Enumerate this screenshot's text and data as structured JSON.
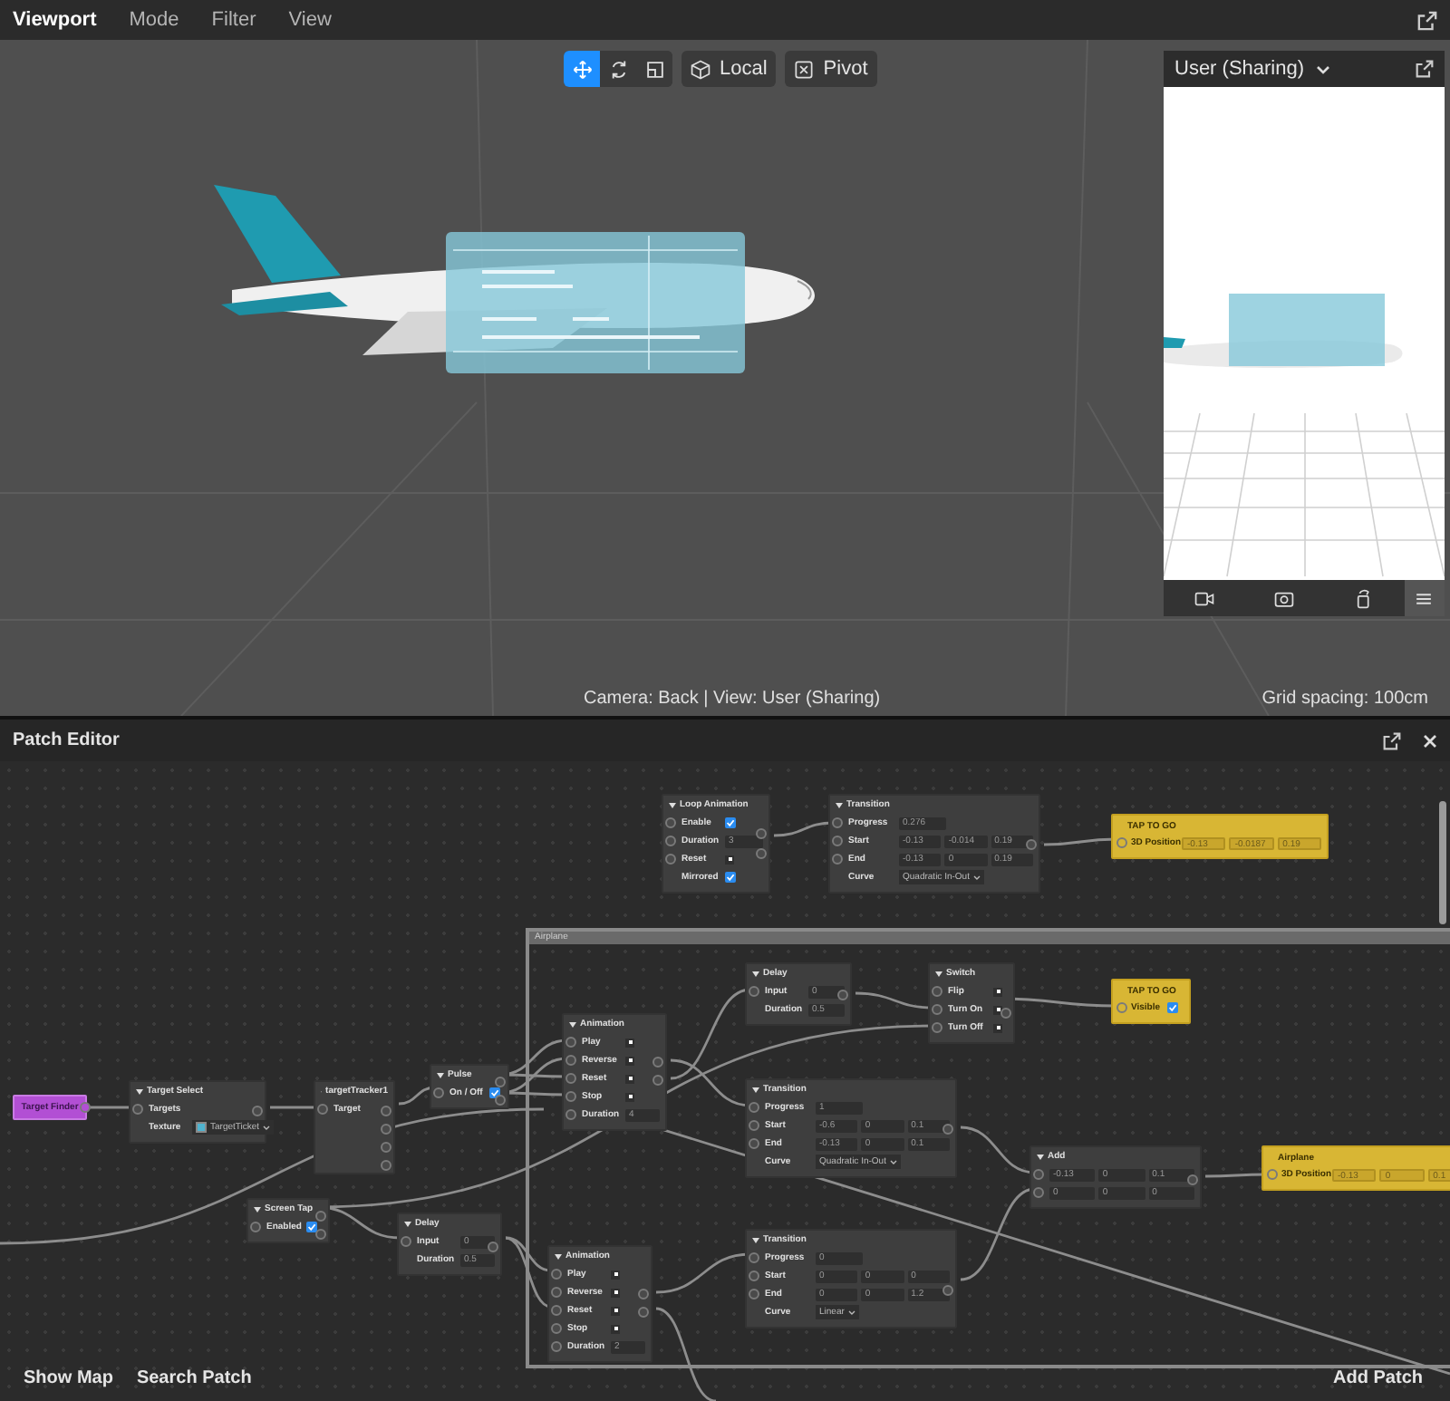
{
  "menu": [
    {
      "label": "Viewport",
      "selected": true
    },
    {
      "label": "Mode",
      "selected": false
    },
    {
      "label": "Filter",
      "selected": false
    },
    {
      "label": "View",
      "selected": false
    }
  ],
  "toolbar": {
    "tools": [
      {
        "kind": "move",
        "selected": true
      },
      {
        "kind": "rotate",
        "selected": false
      },
      {
        "kind": "scale",
        "selected": false
      }
    ],
    "buttons": [
      {
        "kind": "cube",
        "label": "Local"
      },
      {
        "kind": "pivot",
        "label": "Pivot"
      }
    ]
  },
  "preview": {
    "title": "User (Sharing)",
    "tools": [
      {
        "kind": "video",
        "selected": false
      },
      {
        "kind": "camera",
        "selected": false
      },
      {
        "kind": "rotate",
        "selected": false
      },
      {
        "kind": "menu",
        "selected": true
      }
    ]
  },
  "status": {
    "view": "Camera: Back | View: User (Sharing)",
    "grid": "Grid spacing: 100cm"
  },
  "patch_editor": {
    "title": "Patch Editor",
    "groups": [
      {
        "title": "Airplane"
      }
    ],
    "nodes": [
      {
        "kind": "patch",
        "title": "Loop Animation",
        "rows": [
          {
            "kind": "checkbox",
            "label": "Enable",
            "port": true,
            "checked": true
          },
          {
            "kind": "value",
            "label": "Duration",
            "port": true,
            "value": "3"
          },
          {
            "kind": "pulse",
            "label": "Reset",
            "port": true
          },
          {
            "kind": "checkbox",
            "label": "Mirrored",
            "port": false,
            "checked": true
          }
        ]
      },
      {
        "kind": "patch",
        "title": "Transition",
        "rows": [
          {
            "kind": "value",
            "label": "Progress",
            "port": true,
            "value": "0.276"
          },
          {
            "kind": "vector",
            "label": "Start",
            "port": true,
            "values": [
              "-0.13",
              "-0.014",
              "0.19"
            ]
          },
          {
            "kind": "vector",
            "label": "End",
            "port": true,
            "values": [
              "-0.13",
              "0",
              "0.19"
            ]
          },
          {
            "kind": "dropdown",
            "label": "Curve",
            "port": false,
            "value": "Quadratic In-Out"
          }
        ]
      },
      {
        "kind": "object",
        "title": "TAP TO GO",
        "rows": [
          {
            "kind": "vector",
            "label": "3D Position",
            "port": true,
            "values": [
              "-0.13",
              "-0.0187",
              "0.19"
            ]
          }
        ]
      },
      {
        "kind": "patch",
        "title": "Delay",
        "rows": [
          {
            "kind": "value",
            "label": "Input",
            "port": true,
            "value": "0"
          },
          {
            "kind": "value",
            "label": "Duration",
            "port": false,
            "value": "0.5"
          }
        ]
      },
      {
        "kind": "patch",
        "title": "Switch",
        "rows": [
          {
            "kind": "pulse",
            "label": "Flip",
            "port": true
          },
          {
            "kind": "pulse",
            "label": "Turn On",
            "port": true
          },
          {
            "kind": "pulse",
            "label": "Turn Off",
            "port": true
          }
        ]
      },
      {
        "kind": "object",
        "title": "TAP TO GO",
        "rows": [
          {
            "kind": "checkbox",
            "label": "Visible",
            "port": true,
            "checked": true
          }
        ]
      },
      {
        "kind": "patch",
        "title": "Animation",
        "rows": [
          {
            "kind": "pulse",
            "label": "Play",
            "port": true
          },
          {
            "kind": "pulse",
            "label": "Reverse",
            "port": true
          },
          {
            "kind": "pulse",
            "label": "Reset",
            "port": true
          },
          {
            "kind": "pulse",
            "label": "Stop",
            "port": true
          },
          {
            "kind": "value",
            "label": "Duration",
            "port": true,
            "value": "4"
          }
        ]
      },
      {
        "kind": "patch",
        "title": "Transition",
        "rows": [
          {
            "kind": "value",
            "label": "Progress",
            "port": true,
            "value": "1"
          },
          {
            "kind": "vector",
            "label": "Start",
            "port": true,
            "values": [
              "-0.6",
              "0",
              "0.1"
            ]
          },
          {
            "kind": "vector",
            "label": "End",
            "port": true,
            "values": [
              "-0.13",
              "0",
              "0.1"
            ]
          },
          {
            "kind": "dropdown",
            "label": "Curve",
            "port": false,
            "value": "Quadratic In-Out"
          }
        ]
      },
      {
        "kind": "patch",
        "title": "Add",
        "rows": [
          {
            "kind": "vector",
            "port": true,
            "values": [
              "-0.13",
              "0",
              "0.1"
            ]
          },
          {
            "kind": "vector",
            "port": true,
            "values": [
              "0",
              "0",
              "0"
            ]
          }
        ]
      },
      {
        "kind": "object",
        "title": "Airplane",
        "rows": [
          {
            "kind": "vector",
            "label": "3D Position",
            "port": true,
            "values": [
              "-0.13",
              "0",
              "0.1"
            ]
          }
        ]
      },
      {
        "kind": "finder",
        "title": "Target Finder"
      },
      {
        "kind": "patch",
        "title": "Target Select",
        "rows": [
          {
            "kind": "plain",
            "label": "Targets",
            "port": true
          },
          {
            "kind": "dropdown",
            "label": "Texture",
            "port": false,
            "value": "TargetTicket",
            "color": "#4fb3cf"
          }
        ]
      },
      {
        "kind": "patch",
        "title": "targetTracker1",
        "rows": [
          {
            "kind": "plain",
            "label": "Target",
            "port": true
          }
        ]
      },
      {
        "kind": "patch",
        "title": "Pulse",
        "rows": [
          {
            "kind": "checkbox",
            "label": "On / Off",
            "port": true,
            "checked": true
          }
        ]
      },
      {
        "kind": "patch",
        "title": "Screen Tap",
        "rows": [
          {
            "kind": "checkbox",
            "label": "Enabled",
            "port": true,
            "checked": true
          }
        ]
      },
      {
        "kind": "patch",
        "title": "Delay",
        "rows": [
          {
            "kind": "value",
            "label": "Input",
            "port": true,
            "value": "0"
          },
          {
            "kind": "value",
            "label": "Duration",
            "port": false,
            "value": "0.5"
          }
        ]
      },
      {
        "kind": "patch",
        "title": "Animation",
        "rows": [
          {
            "kind": "pulse",
            "label": "Play",
            "port": true
          },
          {
            "kind": "pulse",
            "label": "Reverse",
            "port": true
          },
          {
            "kind": "pulse",
            "label": "Reset",
            "port": true
          },
          {
            "kind": "pulse",
            "label": "Stop",
            "port": true
          },
          {
            "kind": "value",
            "label": "Duration",
            "port": true,
            "value": "2"
          }
        ]
      },
      {
        "kind": "patch",
        "title": "Transition",
        "rows": [
          {
            "kind": "value",
            "label": "Progress",
            "port": true,
            "value": "0"
          },
          {
            "kind": "vector",
            "label": "Start",
            "port": true,
            "values": [
              "0",
              "0",
              "0"
            ]
          },
          {
            "kind": "vector",
            "label": "End",
            "port": true,
            "values": [
              "0",
              "0",
              "1.2"
            ]
          },
          {
            "kind": "dropdown",
            "label": "Curve",
            "port": false,
            "value": "Linear"
          }
        ]
      }
    ],
    "footer": {
      "left": [
        "Show Map",
        "Search Patch"
      ],
      "right": "Add Patch"
    }
  }
}
